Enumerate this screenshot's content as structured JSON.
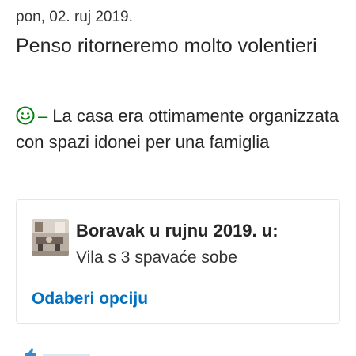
{
  "review": {
    "date": "pon, 02. ruj 2019.",
    "title": "Penso ritorneremo molto volentieri",
    "positive_marker": "–",
    "positive_text": "La casa era ottimamente organizzata con spazi idonei per una famiglia",
    "positive_icon": "smiley-positive-icon"
  },
  "stay": {
    "heading": "Boravak u rujnu 2019. u:",
    "room_type": "Vila s 3 spavaće sobe",
    "action_label": "Odaberi opciju"
  },
  "colors": {
    "positive": "#008009",
    "link": "#0071c2",
    "text": "#262626"
  }
}
